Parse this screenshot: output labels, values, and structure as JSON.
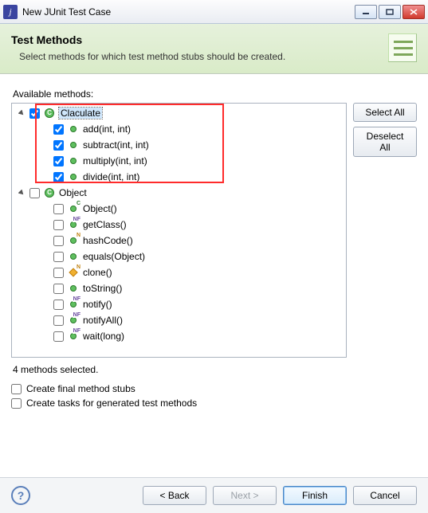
{
  "window": {
    "title": "New JUnit Test Case"
  },
  "header": {
    "title": "Test Methods",
    "description": "Select methods for which test method stubs should be created."
  },
  "labels": {
    "available": "Available methods:",
    "status": "4 methods selected.",
    "select_all": "Select All",
    "deselect_all": "Deselect All",
    "create_final": "Create final method stubs",
    "create_tasks": "Create tasks for generated test methods"
  },
  "tree": {
    "root1": {
      "label": "Claculate",
      "children": [
        {
          "label": "add(int, int)"
        },
        {
          "label": "subtract(int, int)"
        },
        {
          "label": "multiply(int, int)"
        },
        {
          "label": "divide(int, int)"
        }
      ]
    },
    "root2": {
      "label": "Object",
      "children": [
        {
          "label": "Object()",
          "overlay": "C"
        },
        {
          "label": "getClass()",
          "overlay": "NF"
        },
        {
          "label": "hashCode()",
          "overlay": "N"
        },
        {
          "label": "equals(Object)"
        },
        {
          "label": "clone()",
          "overlay": "N",
          "diamond": true
        },
        {
          "label": "toString()"
        },
        {
          "label": "notify()",
          "overlay": "NF"
        },
        {
          "label": "notifyAll()",
          "overlay": "NF"
        },
        {
          "label": "wait(long)",
          "overlay": "NF"
        }
      ]
    }
  },
  "footer": {
    "back": "< Back",
    "next": "Next >",
    "finish": "Finish",
    "cancel": "Cancel"
  }
}
